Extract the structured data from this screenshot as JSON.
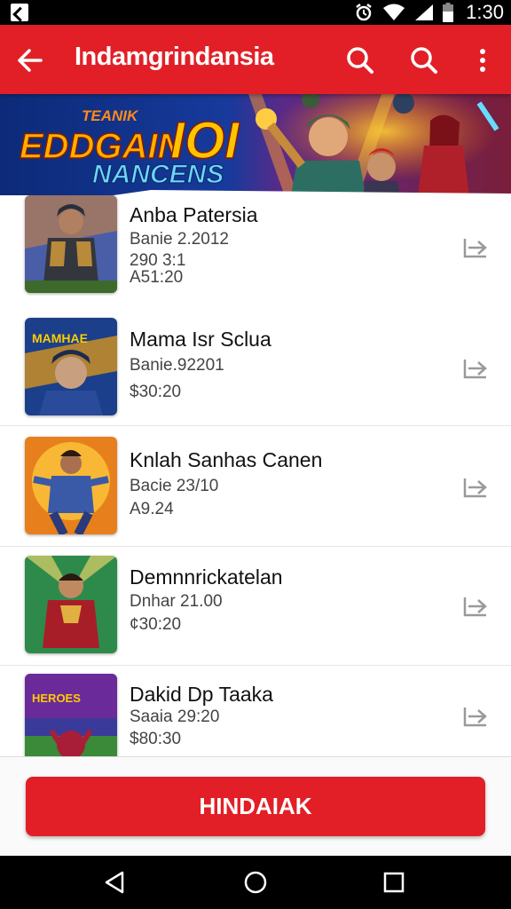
{
  "status_bar": {
    "time": "1:30"
  },
  "app_bar": {
    "title": "Indamgrindansia"
  },
  "banner": {
    "line1": "TEANIK",
    "line2": "EDDGAIN",
    "line3": "IOI",
    "line4": "NANCENS"
  },
  "list": {
    "items": [
      {
        "title": "Anba Patersia",
        "sub1": "Banie 2.2012",
        "sub2": "290 3:1",
        "sub3": "A51:20"
      },
      {
        "title": "Mama Isr Sclua",
        "sub1": "Banie.92201",
        "sub2": "$30:20",
        "sub3": ""
      },
      {
        "title": "Knlah Sanhas Canen",
        "sub1": "Bacie 23/10",
        "sub2": "A9.24",
        "sub3": ""
      },
      {
        "title": "Demnnrickatelan",
        "sub1": "Dnhar 21.00",
        "sub2": "¢30:20",
        "sub3": ""
      },
      {
        "title": "Dakid Dp Taaka",
        "sub1": "Saaia 29:20",
        "sub2": "$80:30",
        "sub3": ""
      }
    ]
  },
  "cta": {
    "label": "HINDAIAK"
  },
  "colors": {
    "accent": "#e21f26"
  }
}
